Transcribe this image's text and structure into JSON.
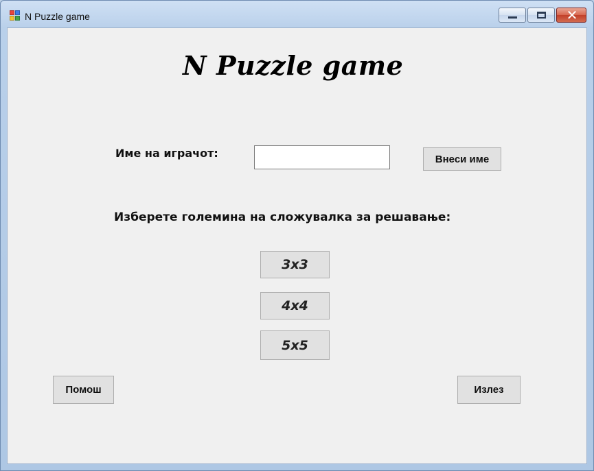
{
  "window": {
    "title": "N Puzzle game",
    "icons": {
      "app": "app-window-icon",
      "minimize": "minimize-icon",
      "maximize": "maximize-icon",
      "close": "close-icon"
    },
    "close_glyph": "✕"
  },
  "form": {
    "heading": "N Puzzle game",
    "player_label": "Име на играчот:",
    "player_name_value": "",
    "enter_name_button": "Внеси име",
    "size_prompt": "Изберете големина на сложувалка за решавање:",
    "size_buttons": [
      "3x3",
      "4x4",
      "5x5"
    ],
    "help_button": "Помош",
    "exit_button": "Излез"
  }
}
